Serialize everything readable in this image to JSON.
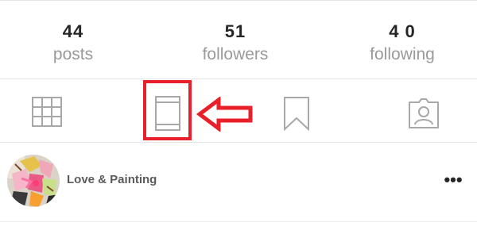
{
  "profile_stats": [
    {
      "count": "44",
      "label": "posts"
    },
    {
      "count": "51",
      "label": "followers"
    },
    {
      "count": "4 0",
      "label": "following"
    }
  ],
  "tabs": [
    {
      "icon": "grid-icon"
    },
    {
      "icon": "single-post-feed-icon",
      "highlighted": true
    },
    {
      "icon": "bookmark-icon"
    },
    {
      "icon": "tagged-photos-icon"
    }
  ],
  "annotation": {
    "color": "#e8202a"
  },
  "post": {
    "title": "Love & Painting",
    "more_icon": "more-options-icon",
    "more_glyph": "•••"
  }
}
